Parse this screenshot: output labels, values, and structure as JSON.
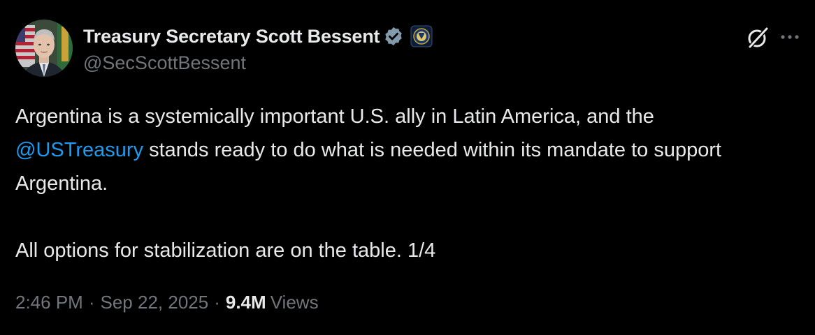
{
  "tweet": {
    "author": {
      "display_name": "Treasury Secretary Scott Bessent",
      "handle": "@SecScottBessent",
      "verified_icon": "verified-badge-icon",
      "affiliate_icon": "treasury-seal-icon"
    },
    "text": {
      "line1": "Argentina is a systemically important U.S. ally in Latin America, and the",
      "mention": "@USTreasury",
      "line2_rest": " stands ready to do what is needed within its mandate to support Argentina.",
      "para2": "All options for stabilization are on the table. 1/4"
    },
    "meta": {
      "time": "2:46 PM",
      "separator": "·",
      "date": "Sep 22, 2025",
      "views_count": "9.4M",
      "views_label": "Views"
    },
    "actions": {
      "grok_icon": "grok-icon",
      "more_icon": "more-options-icon"
    },
    "colors": {
      "background": "#000000",
      "text": "#e7e9ea",
      "secondary": "#71767b",
      "link": "#1d9bf0"
    }
  }
}
